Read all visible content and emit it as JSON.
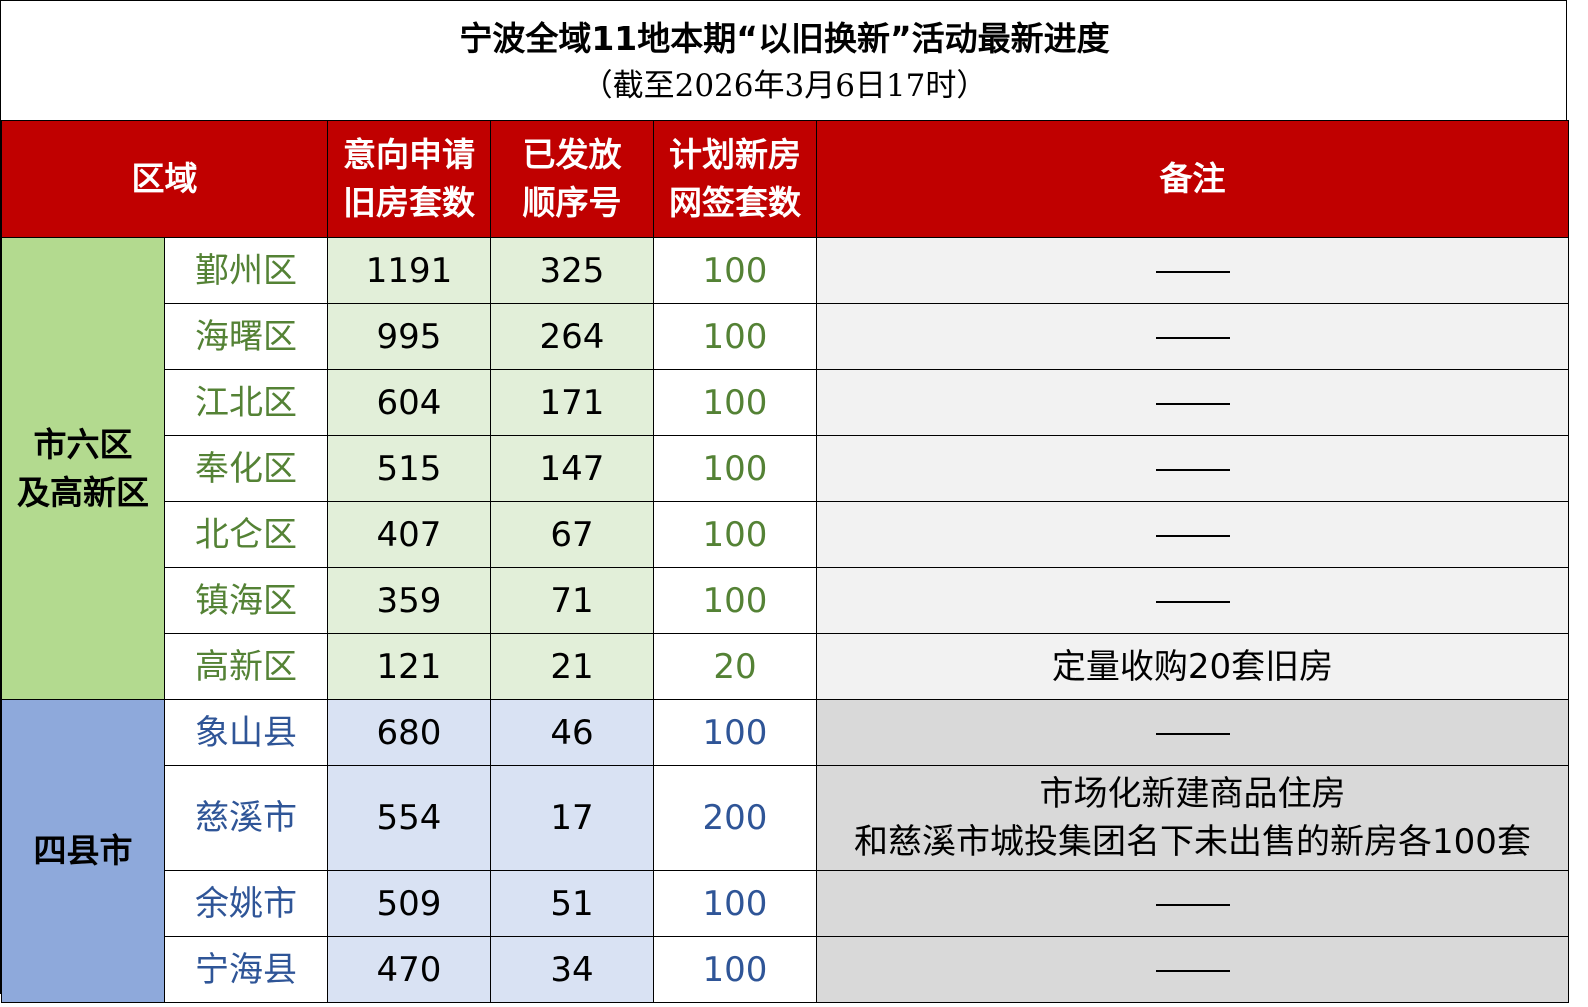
{
  "title": "宁波全域11地本期“以旧换新”活动最新进度",
  "subtitle": "（截至2026年3月6日17时）",
  "headers": {
    "region": "区域",
    "applications_line1": "意向申请",
    "applications_line2": "旧房套数",
    "issued_line1": "已发放",
    "issued_line2": "顺序号",
    "planned_line1": "计划新房",
    "planned_line2": "网签套数",
    "notes": "备注"
  },
  "groups": [
    {
      "name_line1": "市六区",
      "name_line2": "及高新区",
      "color": "#b3da8f",
      "rows": [
        {
          "district": "鄞州区",
          "applications": "1191",
          "issued": "325",
          "planned": "100",
          "note": "——"
        },
        {
          "district": "海曙区",
          "applications": "995",
          "issued": "264",
          "planned": "100",
          "note": "——"
        },
        {
          "district": "江北区",
          "applications": "604",
          "issued": "171",
          "planned": "100",
          "note": "——"
        },
        {
          "district": "奉化区",
          "applications": "515",
          "issued": "147",
          "planned": "100",
          "note": "——"
        },
        {
          "district": "北仑区",
          "applications": "407",
          "issued": "67",
          "planned": "100",
          "note": "——"
        },
        {
          "district": "镇海区",
          "applications": "359",
          "issued": "71",
          "planned": "100",
          "note": "——"
        },
        {
          "district": "高新区",
          "applications": "121",
          "issued": "21",
          "planned": "20",
          "note": "定量收购20套旧房"
        }
      ]
    },
    {
      "name_line1": "四县市",
      "name_line2": "",
      "color": "#8ea9db",
      "rows": [
        {
          "district": "象山县",
          "applications": "680",
          "issued": "46",
          "planned": "100",
          "note": "——"
        },
        {
          "district": "慈溪市",
          "applications": "554",
          "issued": "17",
          "planned": "200",
          "note_line1": "市场化新建商品住房",
          "note_line2": "和慈溪市城投集团名下未出售的新房各100套"
        },
        {
          "district": "余姚市",
          "applications": "509",
          "issued": "51",
          "planned": "100",
          "note": "——"
        },
        {
          "district": "宁海县",
          "applications": "470",
          "issued": "34",
          "planned": "100",
          "note": "——"
        }
      ]
    }
  ],
  "colors": {
    "header_bg": "#c00000",
    "green_text": "#548235",
    "blue_text": "#2f5597",
    "green_cell": "#e2efd9",
    "blue_cell": "#d9e2f3"
  }
}
